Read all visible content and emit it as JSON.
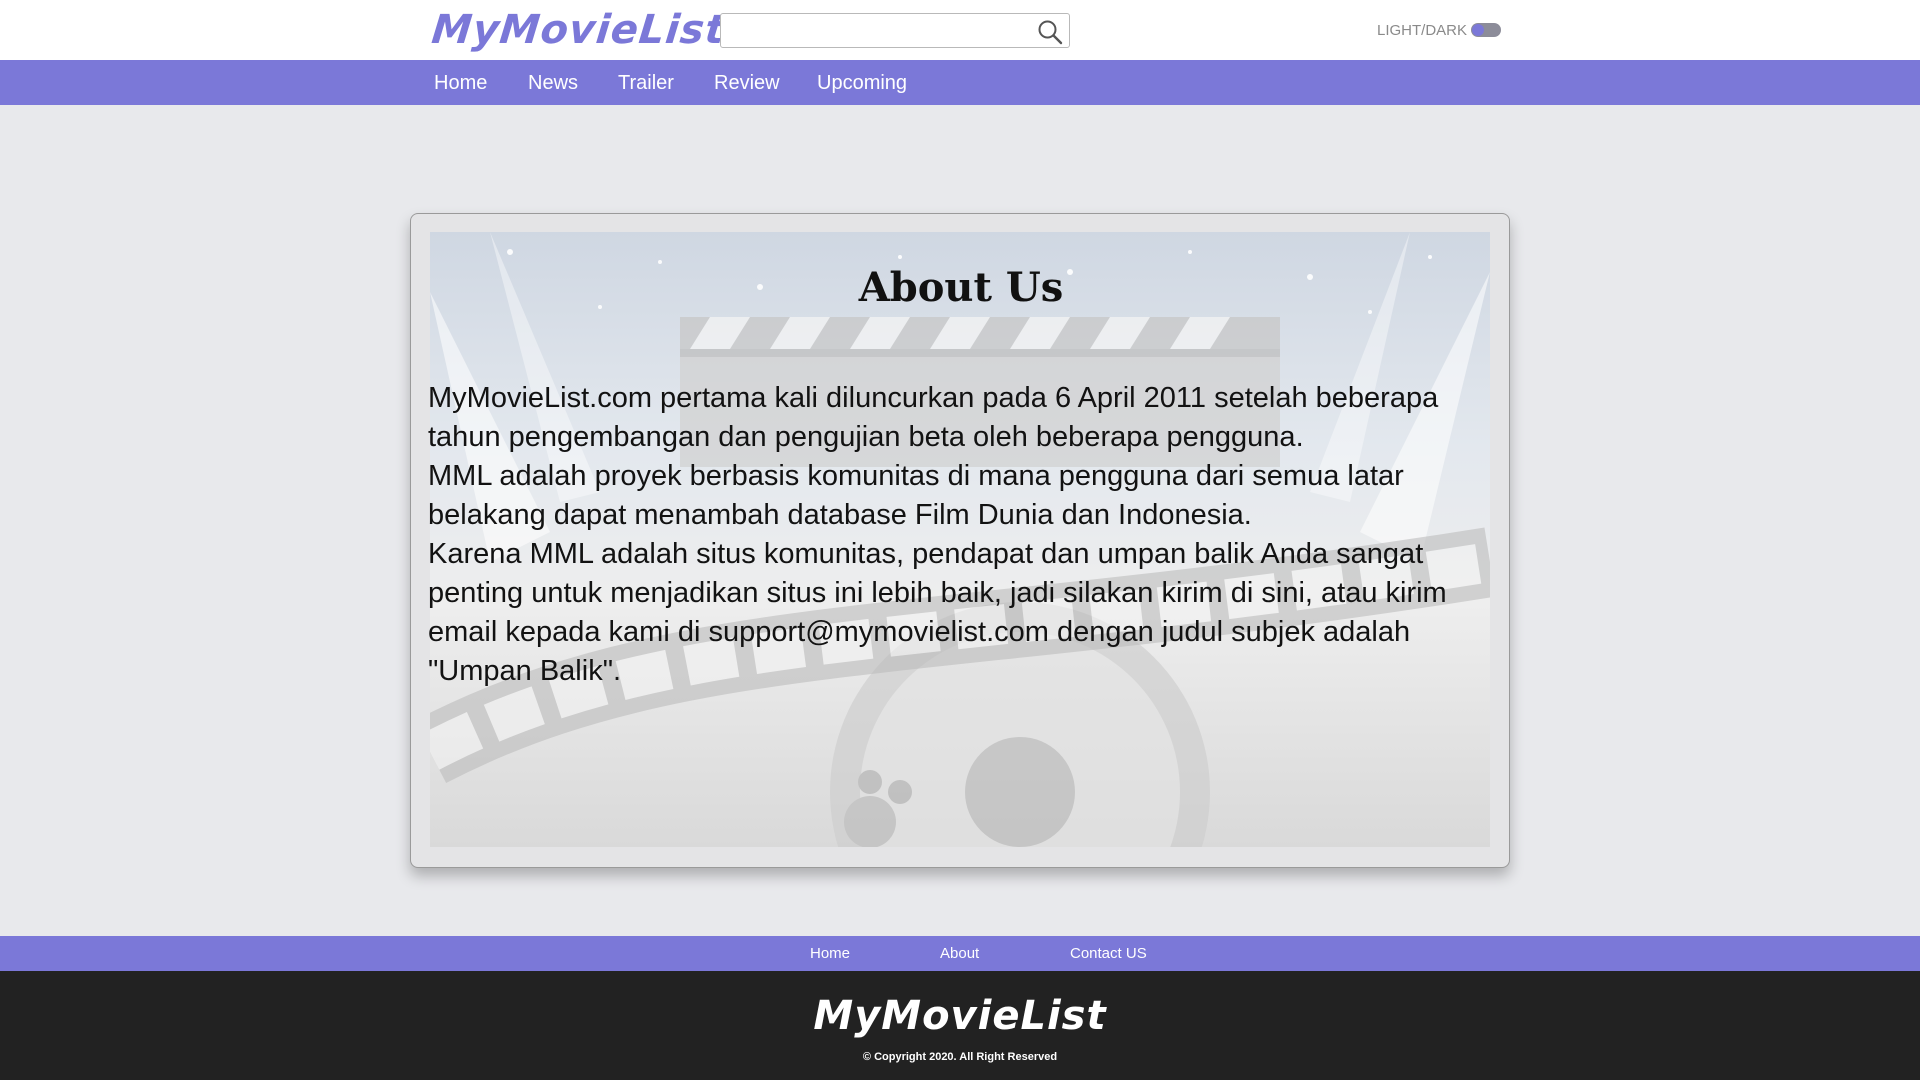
{
  "header": {
    "logo": "MyMovieList",
    "search": {
      "value": "",
      "placeholder": ""
    },
    "theme_toggle_label": "LIGHT/DARK"
  },
  "nav": {
    "items": [
      {
        "label": "Home"
      },
      {
        "label": "News"
      },
      {
        "label": "Trailer"
      },
      {
        "label": "Review"
      },
      {
        "label": "Upcoming"
      }
    ]
  },
  "about": {
    "title": "About Us",
    "paragraphs": [
      "MyMovieList.com pertama kali diluncurkan pada 6 April 2011 setelah beberapa tahun pengembangan dan pengujian beta oleh beberapa pengguna.",
      "MML adalah proyek berbasis komunitas di mana pengguna dari semua latar belakang dapat menambah database Film Dunia dan Indonesia.",
      "Karena MML adalah situs komunitas, pendapat dan umpan balik Anda sangat penting untuk menjadikan situs ini lebih baik, jadi silakan kirim di sini, atau kirim email kepada kami di support@mymovielist.com dengan judul subjek adalah \"Umpan Balik\"."
    ]
  },
  "footer": {
    "links": [
      {
        "label": "Home"
      },
      {
        "label": "About"
      },
      {
        "label": "Contact US"
      }
    ],
    "logo": "MyMovieList",
    "copyright": "© Copyright 2020. All Right Reserved"
  },
  "colors": {
    "accent": "#7b78d8",
    "footer_bg": "#222222",
    "page_bg": "#e8e9ec"
  }
}
